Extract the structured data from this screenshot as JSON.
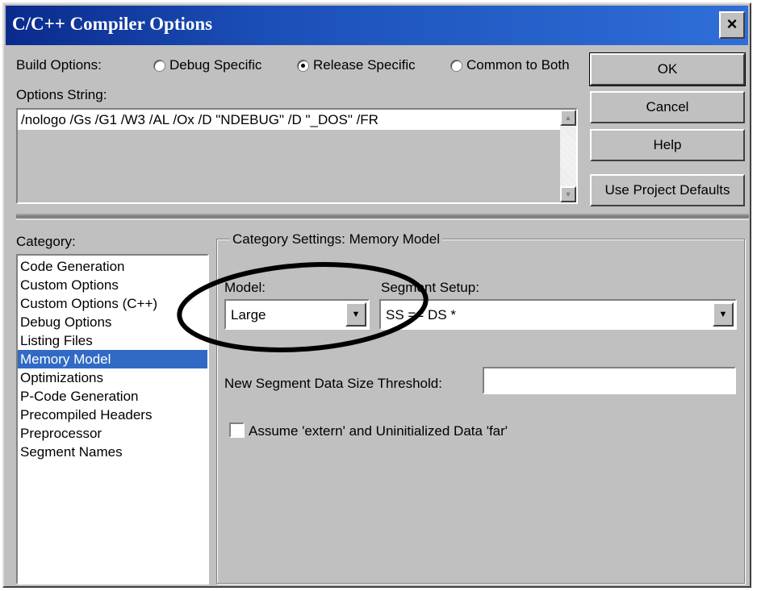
{
  "window": {
    "title": "C/C++ Compiler Options",
    "close_label": "×"
  },
  "build_options": {
    "label": "Build Options:",
    "radios": [
      {
        "label": "Debug Specific",
        "selected": false
      },
      {
        "label": "Release Specific",
        "selected": true
      },
      {
        "label": "Common to Both",
        "selected": false
      }
    ]
  },
  "options_string": {
    "label": "Options String:",
    "value": "/nologo /Gs /G1 /W3 /AL /Ox /D \"NDEBUG\" /D \"_DOS\" /FR"
  },
  "buttons": {
    "ok": "OK",
    "cancel": "Cancel",
    "help": "Help",
    "defaults": "Use Project Defaults"
  },
  "category": {
    "label": "Category:",
    "items": [
      "Code Generation",
      "Custom Options",
      "Custom Options (C++)",
      "Debug Options",
      "Listing Files",
      "Memory Model",
      "Optimizations",
      "P-Code Generation",
      "Precompiled Headers",
      "Preprocessor",
      "Segment Names"
    ],
    "selected": "Memory Model"
  },
  "settings": {
    "group_title": "Category Settings: Memory Model",
    "model_label": "Model:",
    "model_value": "Large",
    "segment_label": "Segment Setup:",
    "segment_value": "SS == DS *",
    "threshold_label": "New Segment Data Size Threshold:",
    "threshold_value": "",
    "checkbox_label": "Assume 'extern' and Uninitialized Data 'far'",
    "checkbox_checked": false
  },
  "annotation_color": "#000000",
  "selection_color": "#316ac5"
}
